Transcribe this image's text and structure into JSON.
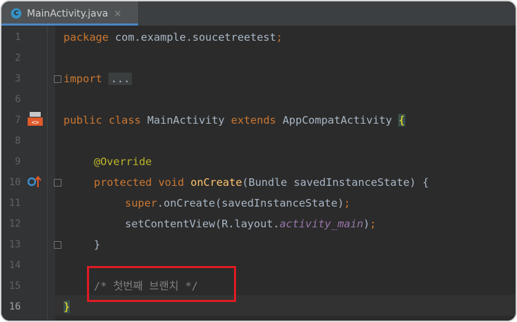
{
  "tab": {
    "icon_letter": "C",
    "title": "MainActivity.java",
    "close": "×"
  },
  "line_numbers": [
    "1",
    "2",
    "3",
    "6",
    "7",
    "8",
    "9",
    "10",
    "11",
    "12",
    "13",
    "14",
    "15",
    "16"
  ],
  "code": {
    "l1": {
      "kw": "package",
      "rest": " com.example.soucetreetest",
      "semi": ";"
    },
    "l3": {
      "kw": "import",
      "dots": "..."
    },
    "l7": {
      "kw1": "public",
      "kw2": "class",
      "name": " MainActivity ",
      "kw3": "extends",
      "parent": " AppCompatActivity ",
      "brace": "{"
    },
    "l9": {
      "annotation": "@Override"
    },
    "l10": {
      "kw1": "protected",
      "kw2": "void",
      "method": "onCreate",
      "params": "(Bundle savedInstanceState) {"
    },
    "l11": {
      "kw": "super",
      "rest": ".onCreate(savedInstanceState)",
      "semi": ";"
    },
    "l12": {
      "call": "setContentView(R.layout.",
      "field": "activity_main",
      "close": ")",
      "semi": ";"
    },
    "l13": {
      "brace": "}"
    },
    "l15": {
      "comment": "/* 첫번째 브랜치 */"
    },
    "l16": {
      "brace": "}"
    }
  },
  "colors": {
    "background": "#2b2b2b",
    "keyword": "#cc7832",
    "annotation": "#bbb529",
    "method": "#ffc66d",
    "field": "#9876aa",
    "comment": "#808080",
    "highlight_box": "#e01b24"
  },
  "icons": [
    "java-class-icon",
    "android-activity-icon",
    "override-method-icon",
    "fold-icon"
  ]
}
